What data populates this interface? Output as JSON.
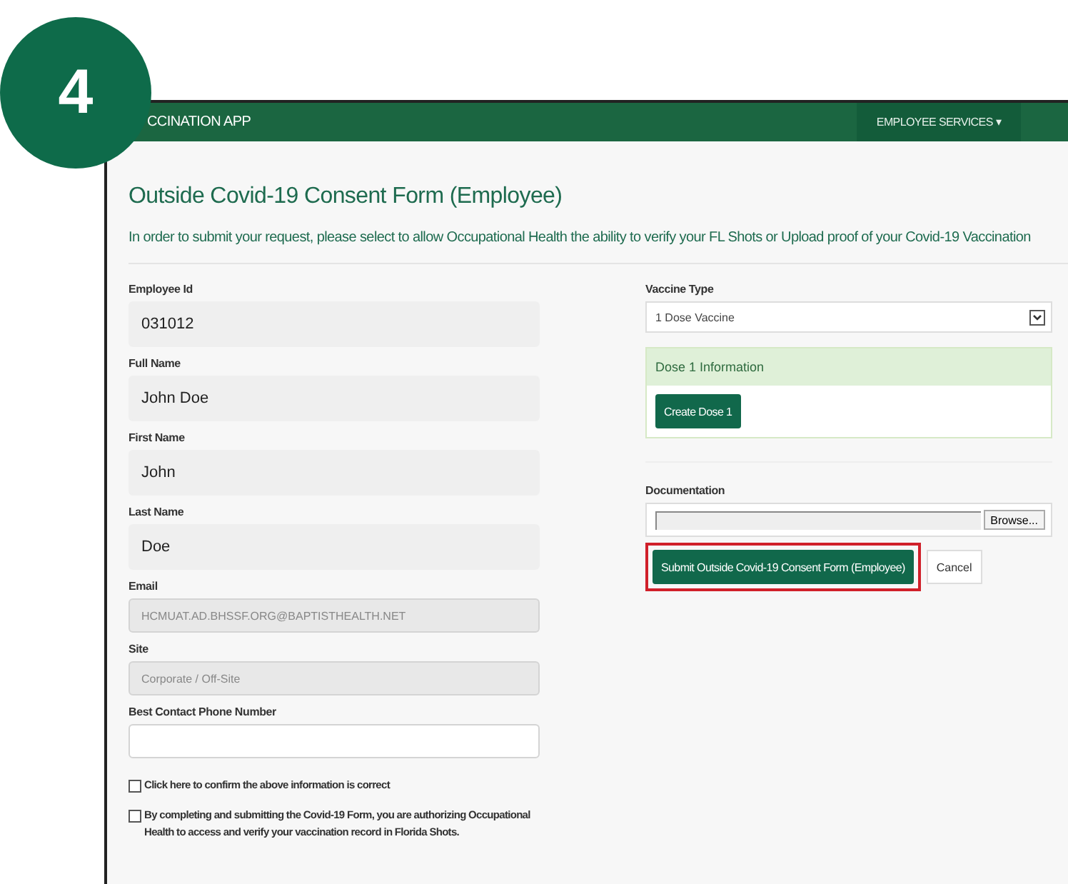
{
  "step_badge": "4",
  "navbar": {
    "app_title": "CCINATION APP",
    "menu": "EMPLOYEE SERVICES",
    "menu_caret": "▾"
  },
  "form": {
    "title": "Outside Covid-19 Consent Form (Employee)",
    "intro": "In order to submit your request, please select to allow Occupational Health the ability to verify your FL Shots or Upload proof of your Covid-19 Vaccination",
    "fields": [
      {
        "label": "Employee Id",
        "value": "031012",
        "kind": "readonly"
      },
      {
        "label": "Full Name",
        "value": "John Doe",
        "kind": "readonly"
      },
      {
        "label": "First Name",
        "value": "John",
        "kind": "readonly"
      },
      {
        "label": "Last Name",
        "value": "Doe",
        "kind": "readonly"
      },
      {
        "label": "Email",
        "value": "HCMUAT.AD.BHSSF.ORG@BAPTISTHEALTH.NET",
        "kind": "disabled"
      },
      {
        "label": "Site",
        "value": "Corporate / Off-Site",
        "kind": "disabled"
      },
      {
        "label": "Best Contact Phone Number",
        "kind": "input"
      }
    ],
    "checkboxes": [
      {
        "label": "Click here to confirm the above information is correct",
        "checked": false
      },
      {
        "label": "By completing and submitting the Covid-19 Form, you are authorizing Occupational Health to access and verify your vaccination record in Florida Shots.",
        "checked": false
      }
    ],
    "vaccine_type": {
      "label": "Vaccine Type",
      "value": "1 Dose Vaccine"
    },
    "dose_panel": {
      "title": "Dose 1 Information",
      "button": "Create Dose 1"
    },
    "documentation": {
      "label": "Documentation",
      "browse": "Browse..."
    },
    "submit": {
      "label": "Submit Outside Covid-19 Consent Form (Employee)",
      "highlighted": true
    },
    "cancel": "Cancel"
  }
}
